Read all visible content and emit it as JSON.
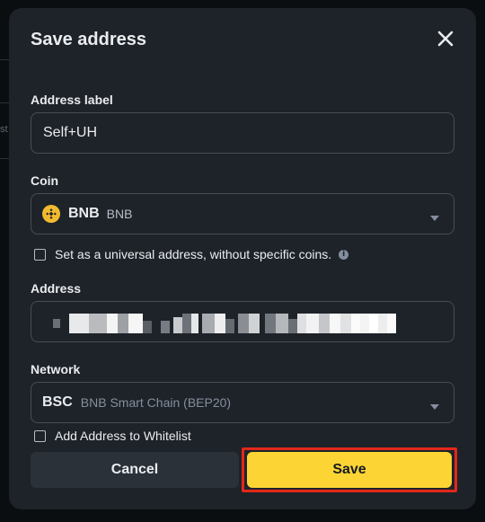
{
  "background": {
    "partial_text": "st"
  },
  "modal": {
    "title": "Save address",
    "close_icon": "close-icon"
  },
  "address_label": {
    "label": "Address label",
    "value": "Self+UH"
  },
  "coin": {
    "label": "Coin",
    "code": "BNB",
    "name": "BNB",
    "icon": "bnb-coin-icon",
    "accent": "#F3BA2F"
  },
  "universal": {
    "label": "Set as a universal address, without specific coins.",
    "info_icon": "i",
    "checked": false
  },
  "address": {
    "label": "Address",
    "value_redacted": true
  },
  "network": {
    "label": "Network",
    "code": "BSC",
    "name": "BNB Smart Chain (BEP20)"
  },
  "whitelist": {
    "label": "Add Address to Whitelist",
    "checked": false
  },
  "actions": {
    "cancel_label": "Cancel",
    "save_label": "Save",
    "save_color": "#FCD535",
    "highlight_color": "#E3281B"
  }
}
